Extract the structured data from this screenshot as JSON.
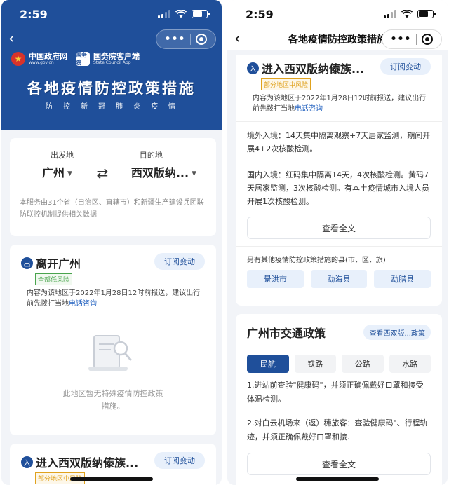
{
  "left": {
    "status": {
      "time": "2:59"
    },
    "header": {
      "logo1_cn": "中国政府网",
      "logo1_en": "www.gov.cn",
      "logo2_icon_text": "国务院",
      "logo2_cn": "国务院客户端",
      "logo2_en": "State Council App",
      "title": "各地疫情防控政策措施",
      "subtitle": "防控新冠肺炎疫情"
    },
    "route": {
      "from_label": "出发地",
      "from_value": "广州",
      "to_label": "目的地",
      "to_value": "西双版纳...",
      "note": "本服务由31个省（自治区、直辖市）和新疆生产建设兵团联防联控机制提供相关数据"
    },
    "leave": {
      "badge": "出",
      "name": "离开广州",
      "subscribe": "订阅变动",
      "risk": "全部低风险",
      "note_prefix": "内容为该地区于2022年1月28日12时前报送，建议出行前先拨打当地",
      "note_link": "电话咨询",
      "empty": "此地区暂无特殊疫情防控政策措施。"
    },
    "enter": {
      "badge": "入",
      "name": "进入西双版纳傣族...",
      "subscribe": "订阅变动",
      "risk": "部分地区中风险"
    }
  },
  "right": {
    "status": {
      "time": "2:59"
    },
    "nav_title": "各地疫情防控政策措施",
    "enter": {
      "badge": "入",
      "name": "进入西双版纳傣族...",
      "subscribe": "订阅变动",
      "risk": "部分地区中风险",
      "note_prefix": "内容为该地区于2022年1月28日12时前报送，建议出行前先拨打当地",
      "note_link": "电话咨询",
      "abroad": "境外入境：14天集中隔离观察+7天居家监测，期间开展4+2次核酸检测。",
      "domestic": "国内入境：红码集中隔离14天，4次核酸检测。黄码7天居家监测，3次核酸检测。有本土疫情城市入境人员开展1次核酸检测。",
      "view_all": "查看全文",
      "other_label": "另有其他疫情防控政策措施的县(市、区、旗)",
      "counties": [
        "景洪市",
        "勐海县",
        "勐腊县"
      ]
    },
    "traffic": {
      "title": "广州市交通政策",
      "link": "查看西双版...政策",
      "tabs": [
        "民航",
        "铁路",
        "公路",
        "水路"
      ],
      "p1": "1.进站前查验\"健康码\"，并须正确佩戴好口罩和接受体温检测。",
      "p2": "2.对白云机场来（返）穗旅客：查验健康码\"、行程轨迹，并须正确佩戴好口罩和接.",
      "view_all": "查看全文"
    }
  },
  "colors": {
    "brand": "#1f4f9a",
    "low_risk": "#49a44d",
    "mid_risk": "#e0a21e",
    "link": "#1f5fbf"
  }
}
